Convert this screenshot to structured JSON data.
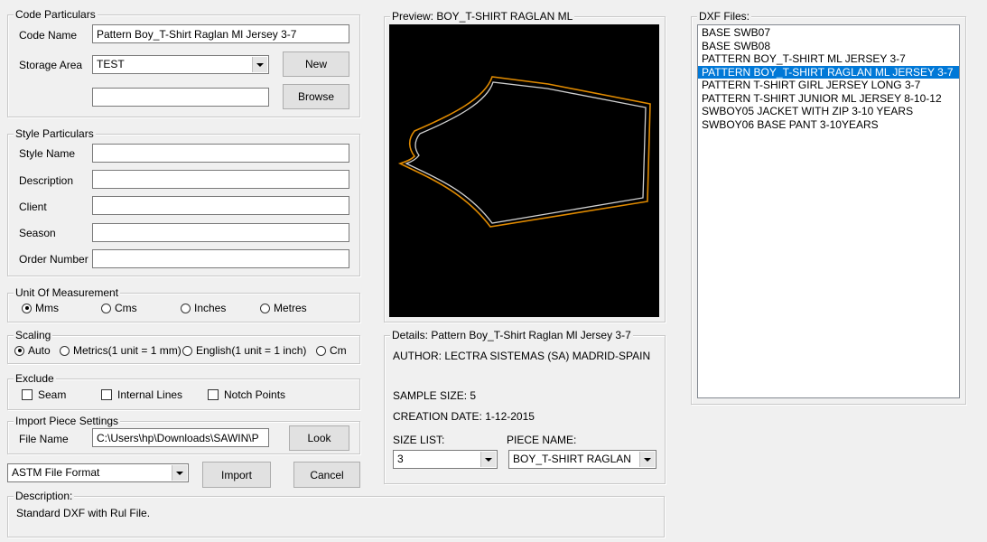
{
  "code_particulars": {
    "title": "Code Particulars",
    "code_name_label": "Code Name",
    "code_name_value": "Pattern Boy_T-Shirt Raglan Ml Jersey 3-7",
    "storage_area_label": "Storage Area",
    "storage_area_value": "TEST",
    "new_button": "New",
    "browse_value": "",
    "browse_button": "Browse"
  },
  "style_particulars": {
    "title": "Style Particulars",
    "fields": [
      {
        "label": "Style Name",
        "value": ""
      },
      {
        "label": "Description",
        "value": ""
      },
      {
        "label": "Client",
        "value": ""
      },
      {
        "label": "Season",
        "value": ""
      },
      {
        "label": "Order Number",
        "value": ""
      }
    ]
  },
  "unit_of_measurement": {
    "title": "Unit Of Measurement",
    "options": [
      "Mms",
      "Cms",
      "Inches",
      "Metres"
    ],
    "selected": "Mms"
  },
  "scaling": {
    "title": "Scaling",
    "options": [
      "Auto",
      "Metrics(1 unit = 1 mm)",
      "English(1 unit = 1 inch)",
      "Cm"
    ],
    "selected": "Auto"
  },
  "exclude": {
    "title": "Exclude",
    "options": [
      "Seam",
      "Internal Lines",
      "Notch Points"
    ]
  },
  "import_piece_settings": {
    "title": "Import Piece Settings",
    "file_name_label": "File Name",
    "file_name_value": "C:\\Users\\hp\\Downloads\\SAWIN\\P",
    "look_button": "Look"
  },
  "file_format": {
    "value": "ASTM File Format",
    "import_button": "Import",
    "cancel_button": "Cancel"
  },
  "description": {
    "title": "Description:",
    "text": "Standard DXF with Rul File."
  },
  "preview": {
    "title": "Preview: BOY_T-SHIRT RAGLAN  ML",
    "outline_color": "#e08a00",
    "inner_color": "#d0d0d0",
    "background": "#000000"
  },
  "details": {
    "title": "Details: Pattern Boy_T-Shirt Raglan Ml Jersey 3-7",
    "author": "AUTHOR: LECTRA SISTEMAS (SA) MADRID-SPAIN",
    "sample_size": "SAMPLE SIZE: 5",
    "creation_date": "CREATION DATE: 1-12-2015",
    "size_list_label": "SIZE LIST:",
    "size_list_value": "3",
    "piece_name_label": "PIECE NAME:",
    "piece_name_value": "BOY_T-SHIRT RAGLAN"
  },
  "dxf_files": {
    "title": "DXF Files:",
    "items": [
      "BASE SWB07",
      "BASE SWB08",
      "PATTERN BOY_T-SHIRT ML JERSEY 3-7",
      "PATTERN BOY_T-SHIRT RAGLAN ML JERSEY 3-7",
      "PATTERN T-SHIRT GIRL JERSEY LONG 3-7",
      "PATTERN T-SHIRT JUNIOR ML JERSEY 8-10-12",
      "SWBOY05 JACKET WITH ZIP 3-10 YEARS",
      "SWBOY06 BASE PANT 3-10YEARS"
    ],
    "selected_index": 3,
    "selected_color": "#0078d7"
  }
}
